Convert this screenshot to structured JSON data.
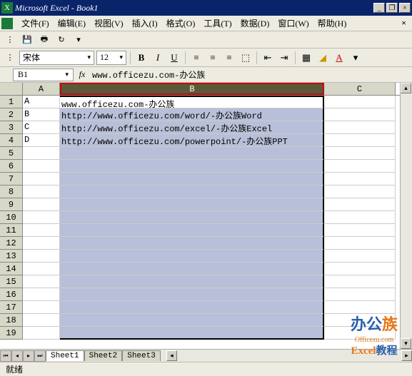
{
  "title": "Microsoft Excel - Book1",
  "menus": {
    "file": "文件(F)",
    "edit": "编辑(E)",
    "view": "视图(V)",
    "insert": "插入(I)",
    "format": "格式(O)",
    "tools": "工具(T)",
    "data": "数据(D)",
    "window": "窗口(W)",
    "help": "帮助(H)"
  },
  "font": {
    "name": "宋体",
    "size": "12"
  },
  "namebox": "B1",
  "formula": "www.officezu.com-办公族",
  "columns": {
    "A": "A",
    "B": "B",
    "C": "C"
  },
  "rows": [
    {
      "n": "1",
      "A": "A",
      "B": "www.officezu.com-办公族"
    },
    {
      "n": "2",
      "A": "B",
      "B": "http://www.officezu.com/word/-办公族Word"
    },
    {
      "n": "3",
      "A": "C",
      "B": "http://www.officezu.com/excel/-办公族Excel"
    },
    {
      "n": "4",
      "A": "D",
      "B": "http://www.officezu.com/powerpoint/-办公族PPT"
    },
    {
      "n": "5",
      "A": "",
      "B": ""
    },
    {
      "n": "6",
      "A": "",
      "B": ""
    },
    {
      "n": "7",
      "A": "",
      "B": ""
    },
    {
      "n": "8",
      "A": "",
      "B": ""
    },
    {
      "n": "9",
      "A": "",
      "B": ""
    },
    {
      "n": "10",
      "A": "",
      "B": ""
    },
    {
      "n": "11",
      "A": "",
      "B": ""
    },
    {
      "n": "12",
      "A": "",
      "B": ""
    },
    {
      "n": "13",
      "A": "",
      "B": ""
    },
    {
      "n": "14",
      "A": "",
      "B": ""
    },
    {
      "n": "15",
      "A": "",
      "B": ""
    },
    {
      "n": "16",
      "A": "",
      "B": ""
    },
    {
      "n": "17",
      "A": "",
      "B": ""
    },
    {
      "n": "18",
      "A": "",
      "B": ""
    },
    {
      "n": "19",
      "A": "",
      "B": ""
    }
  ],
  "sheets": {
    "s1": "Sheet1",
    "s2": "Sheet2",
    "s3": "Sheet3"
  },
  "status": "就绪",
  "wm": {
    "brand1": "办公",
    "brand2": "族",
    "url": "Officezu.com",
    "line2a": "Excel",
    "line2b": "教程"
  }
}
